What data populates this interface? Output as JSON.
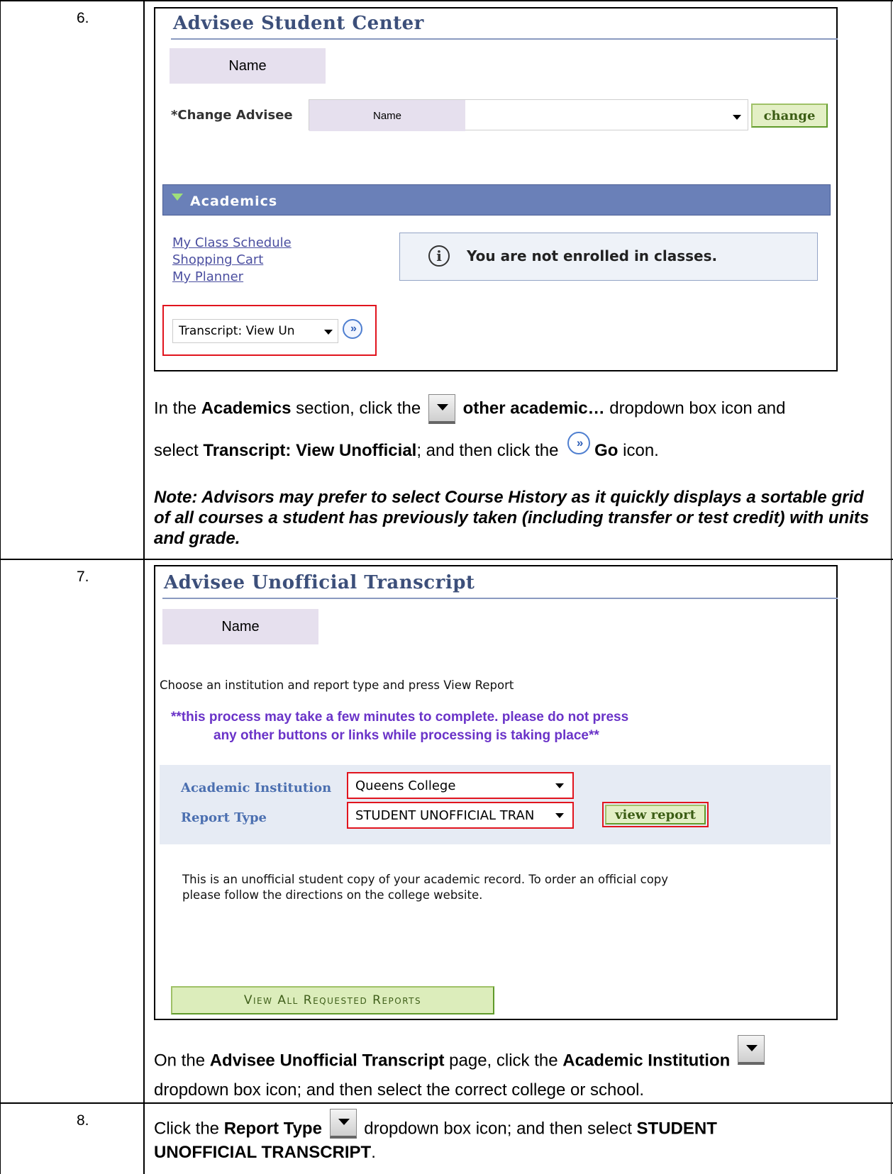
{
  "steps": [
    {
      "number": "6."
    },
    {
      "number": "7."
    },
    {
      "number": "8."
    }
  ],
  "step6": {
    "screenshot": {
      "title": "Advisee Student Center",
      "name_placeholder": "Name",
      "change_advisee_label": "*Change Advisee",
      "advisee_select_value": "Name",
      "change_button": "change",
      "section_header": "Academics",
      "links": [
        "My Class Schedule",
        "Shopping Cart",
        "My Planner"
      ],
      "info_message": "You are not enrolled in classes.",
      "academic_dropdown_value": "Transcript: View Un"
    },
    "instruction": {
      "p1": "In the ",
      "p1b": "Academics",
      "p2": " section, click the ",
      "p3b": "other academic…",
      "p4": " dropdown box icon and",
      "p5": "select ",
      "p5b": "Transcript:  View Unofficial",
      "p6": "; and then click the ",
      "p7b": "Go",
      "p8": " icon."
    },
    "note": "Note:  Advisors may prefer to select Course History as it quickly displays a sortable grid of all courses a student has previously taken (including transfer or test credit) with units and grade."
  },
  "step7": {
    "screenshot": {
      "title": "Advisee Unofficial Transcript",
      "name_placeholder": "Name",
      "instruction": "Choose an institution and report type and press View Report",
      "warning_line1": "**this process may take a few minutes to complete. please do not press",
      "warning_line2": "any other buttons or links while processing is taking place**",
      "institution_label": "Academic Institution",
      "institution_value": "Queens College",
      "report_type_label": "Report Type",
      "report_type_value": "STUDENT UNOFFICIAL TRAN",
      "view_report_button": "view report",
      "disclaimer_line1": "This is an unofficial student copy of your academic record.  To order an official copy",
      "disclaimer_line2": "please follow the directions on the college website.",
      "view_all_button": "View All Requested Reports"
    },
    "instruction": {
      "p1": "On the ",
      "p1b": "Advisee Unofficial Transcript",
      "p2": " page, click the ",
      "p2b": "Academic Institution",
      "p3": "dropdown box icon; and then select the correct college or school."
    }
  },
  "step8": {
    "instruction": {
      "p1": "Click the ",
      "p1b": "Report Type",
      "p2": " dropdown box icon; and then select ",
      "p2b": "STUDENT",
      "p3b": "UNOFFICIAL TRANSCRIPT",
      "p3": "."
    }
  }
}
